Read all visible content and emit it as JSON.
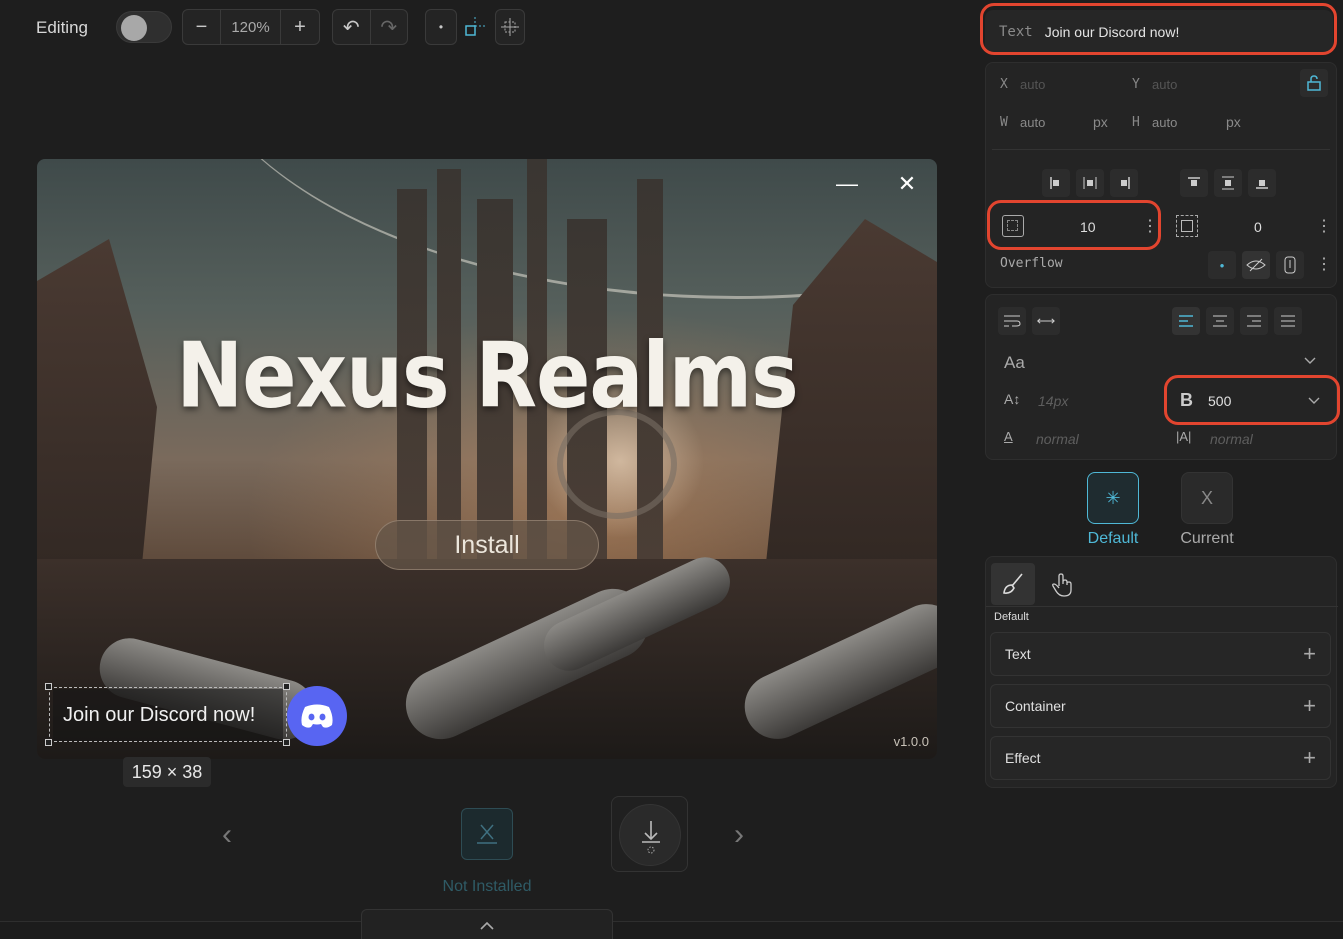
{
  "toolbar": {
    "editing_label": "Editing",
    "zoom_minus": "−",
    "zoom_value": "120%",
    "zoom_plus": "+",
    "undo": "↶",
    "redo": "↷",
    "dot": "•"
  },
  "preview": {
    "minimize": "—",
    "close": "✕",
    "game_title": "Nexus Realms",
    "install_label": "Install",
    "discord_text": "Join our Discord now!",
    "version": "v1.0.0"
  },
  "selection_size": "159 × 38",
  "launcher": {
    "prev": "‹",
    "next": "›",
    "status_label": "Not Installed"
  },
  "panel": {
    "text_row": {
      "tag": "Text",
      "value": "Join our Discord now!"
    },
    "position": {
      "x_label": "X",
      "x_value": "auto",
      "y_label": "Y",
      "y_value": "auto",
      "w_label": "W",
      "w_value": "auto",
      "w_unit": "px",
      "h_label": "H",
      "h_value": "auto",
      "h_unit": "px"
    },
    "padding_value": "10",
    "margin_value": "0",
    "overflow_label": "Overflow",
    "typography": {
      "font_icon_label": "Aa",
      "size_placeholder": "14px",
      "weight_value": "500",
      "letter_spacing": "normal",
      "line_height": "normal"
    },
    "states": [
      {
        "label": "Default",
        "glyph": "✳"
      },
      {
        "label": "Current",
        "glyph": "X"
      }
    ],
    "style_tab_label": "Default",
    "sections": [
      "Text",
      "Container",
      "Effect"
    ]
  },
  "colors": {
    "accent": "#4fb8d6",
    "highlight": "#e2452f",
    "discord": "#5865f2"
  }
}
